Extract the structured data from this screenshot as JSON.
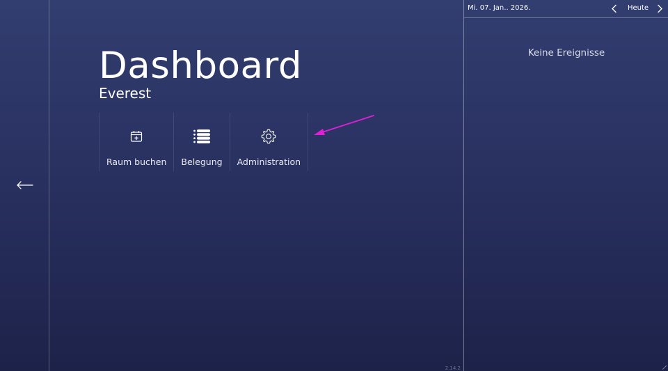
{
  "dashboard": {
    "title": "Dashboard",
    "room": "Everest",
    "version": "2.14.2",
    "tiles": [
      {
        "label": "Raum buchen",
        "icon": "calendar-plus-icon"
      },
      {
        "label": "Belegung",
        "icon": "list-icon"
      },
      {
        "label": "Administration",
        "icon": "gear-icon"
      }
    ]
  },
  "nav": {
    "back_icon": "arrow-left-icon"
  },
  "calendar": {
    "date": "Mi. 07. Jan.. 2026.",
    "today_label": "Heute",
    "prev_icon": "chevron-left-icon",
    "next_icon": "chevron-right-icon",
    "empty_message": "Keine Ereignisse"
  },
  "colors": {
    "background_top": "#323e70",
    "background_bottom": "#1d2249",
    "annotation_arrow": "#e020d8"
  }
}
